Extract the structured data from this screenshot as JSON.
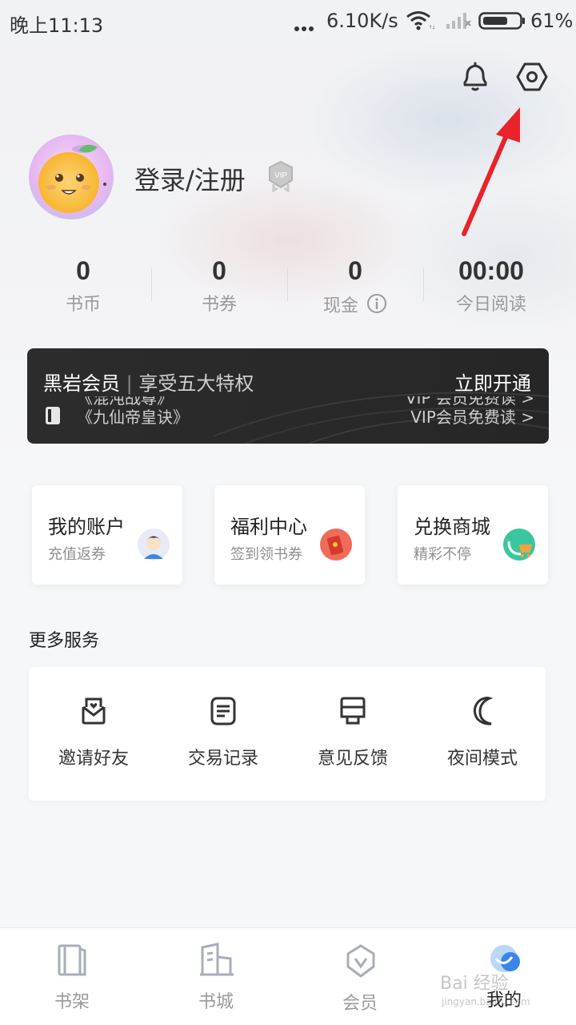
{
  "status_bar": {
    "time": "晚上11:13",
    "speed": "6.10K/s",
    "battery": "61%"
  },
  "header": {
    "icons": [
      "bell-icon",
      "settings-icon"
    ]
  },
  "profile": {
    "login_label": "登录/注册",
    "vip_badge": "VIP"
  },
  "stats": [
    {
      "value": "0",
      "label": "书币"
    },
    {
      "value": "0",
      "label": "书券"
    },
    {
      "value": "0",
      "label": "现金"
    },
    {
      "value": "00:00",
      "label": "今日阅读"
    }
  ],
  "vip_banner": {
    "title": "黑岩会员",
    "separator": "|",
    "subtitle": "享受五大特权",
    "cta": "立即开通",
    "ticker_left": [
      "《混沌战尊》",
      "《九仙帝皇诀》"
    ],
    "ticker_right": [
      "VIP 会员免费读 >",
      "VIP会员免费读 >"
    ]
  },
  "cards": [
    {
      "title": "我的账户",
      "subtitle": "充值返券",
      "color": "#e8eaf6"
    },
    {
      "title": "福利中心",
      "subtitle": "签到领书券",
      "color": "#f06b5a"
    },
    {
      "title": "兑换商城",
      "subtitle": "精彩不停",
      "color": "#3cc6a0"
    }
  ],
  "more_services": {
    "title": "更多服务",
    "items": [
      {
        "label": "邀请好友",
        "icon": "invite-icon"
      },
      {
        "label": "交易记录",
        "icon": "record-icon"
      },
      {
        "label": "意见反馈",
        "icon": "feedback-icon"
      },
      {
        "label": "夜间模式",
        "icon": "moon-icon"
      }
    ]
  },
  "bottom_nav": {
    "items": [
      {
        "label": "书架",
        "icon": "bookshelf-icon"
      },
      {
        "label": "书城",
        "icon": "bookstore-icon"
      },
      {
        "label": "会员",
        "icon": "member-icon"
      },
      {
        "label": "我的",
        "icon": "profile-icon"
      }
    ],
    "active": "我的"
  },
  "watermark": {
    "text": "Bai 经验",
    "url": "jingyan.baidu.com"
  },
  "colors": {
    "accent_red": "#e8232a",
    "banner_bg": "#2a2a2a",
    "nav_active": "#3a86e8"
  }
}
